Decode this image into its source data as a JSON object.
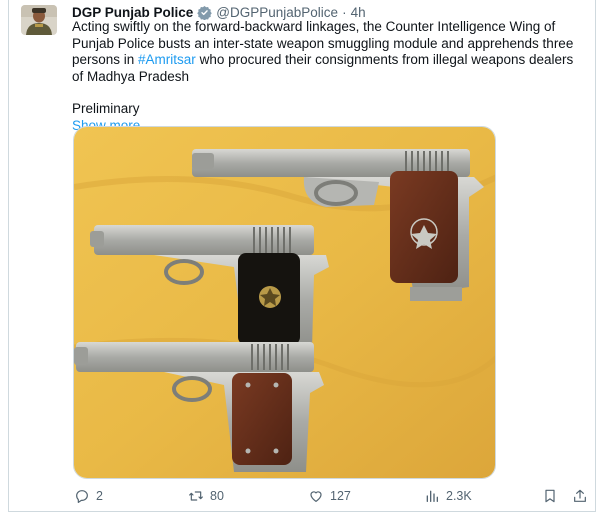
{
  "tweet": {
    "author_name": "DGP Punjab Police",
    "handle": "@DGPPunjabPolice",
    "separator": "·",
    "time": "4h",
    "text_before_hashtag": "Acting swiftly on the forward-backward linkages, the Counter Intelligence Wing of Punjab Police busts an inter-state weapon smuggling module and apprehends three persons in ",
    "hashtag": "#Amritsar",
    "text_after_hashtag": " who procured their consignments from illegal weapons dealers of Madhya Pradesh",
    "preliminary": "Preliminary",
    "show_more": "Show more"
  },
  "actions": {
    "replies": "2",
    "reposts": "80",
    "likes": "127",
    "views": "2.3K"
  },
  "colors": {
    "accent": "#1d9bf0",
    "muted": "#536471",
    "photo_background": "#e9b946"
  },
  "icons": [
    "verified-badge-icon",
    "reply-icon",
    "repost-icon",
    "like-icon",
    "views-icon",
    "bookmark-icon",
    "share-icon"
  ]
}
